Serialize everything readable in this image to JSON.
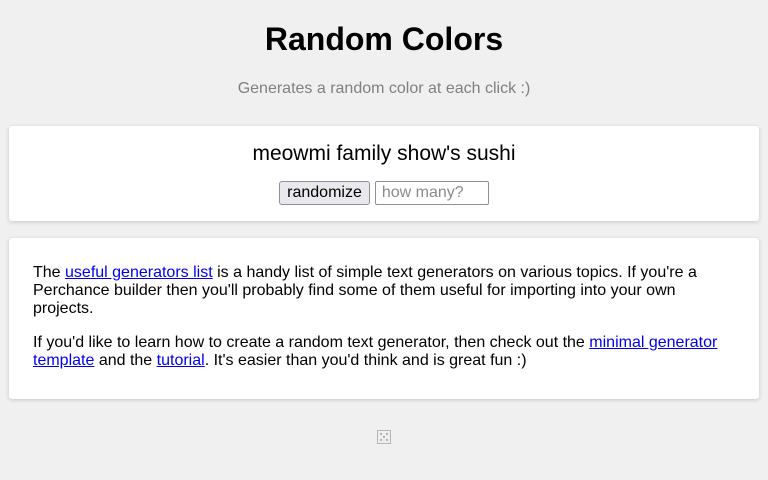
{
  "header": {
    "title": "Random Colors",
    "subtitle": "Generates a random color at each click :)"
  },
  "output": {
    "text": "meowmi family show's sushi"
  },
  "controls": {
    "randomize_label": "randomize",
    "count_placeholder": "how many?",
    "count_value": ""
  },
  "info": {
    "p1_before": "The ",
    "p1_link": "useful generators list",
    "p1_after": " is a handy list of simple text generators on various topics. If you're a Perchance builder then you'll probably find some of them useful for importing into your own projects.",
    "p2_before": "If you'd like to learn how to create a random text generator, then check out the ",
    "p2_link1": "minimal generator template",
    "p2_mid": " and the ",
    "p2_link2": "tutorial",
    "p2_after": ". It's easier than you'd think and is great fun :)"
  },
  "footer": {
    "icon": "dice-icon"
  },
  "colors": {
    "background": "#f0f0f0",
    "card": "#ffffff",
    "subtitle": "#808080",
    "link": "#0000ee"
  }
}
